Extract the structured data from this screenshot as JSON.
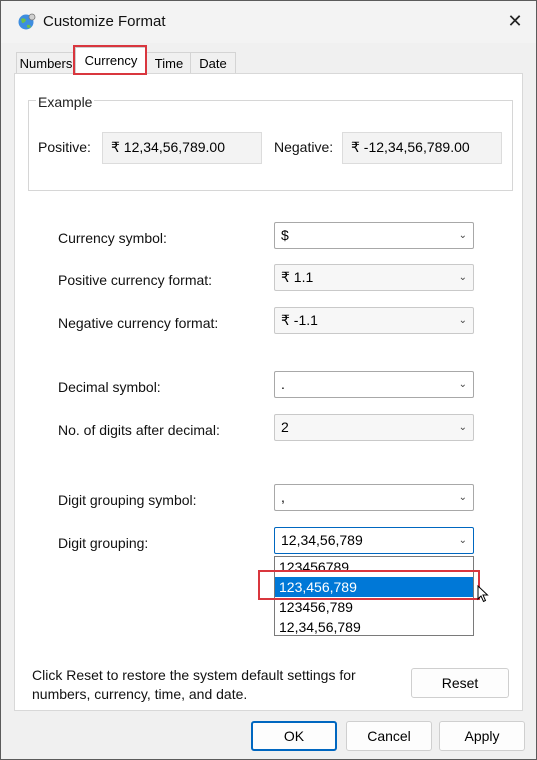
{
  "window": {
    "title": "Customize Format"
  },
  "tabs": [
    "Numbers",
    "Currency",
    "Time",
    "Date"
  ],
  "example": {
    "title": "Example",
    "positive_label": "Positive:",
    "positive_value": "₹ 12,34,56,789.00",
    "negative_label": "Negative:",
    "negative_value": "₹ -12,34,56,789.00"
  },
  "fields": [
    {
      "label": "Currency symbol:",
      "value": "$"
    },
    {
      "label": "Positive currency format:",
      "value": "₹ 1.1"
    },
    {
      "label": "Negative currency format:",
      "value": "₹ -1.1"
    },
    {
      "label": "Decimal symbol:",
      "value": "."
    },
    {
      "label": "No. of digits after decimal:",
      "value": "2"
    },
    {
      "label": "Digit grouping symbol:",
      "value": ","
    },
    {
      "label": "Digit grouping:",
      "value": "12,34,56,789"
    }
  ],
  "digit_grouping_options": [
    "123456789",
    "123,456,789",
    "123456,789",
    "12,34,56,789"
  ],
  "digit_grouping_highlighted": "123,456,789",
  "reset_note": "Click Reset to restore the system default settings for numbers, currency, time, and date.",
  "buttons": {
    "reset": "Reset",
    "ok": "OK",
    "cancel": "Cancel",
    "apply": "Apply"
  },
  "colors": {
    "selection": "#0078d7",
    "highlight_box": "#d9363e",
    "primary_border": "#0067c0"
  },
  "icons": {
    "app": "globe-settings-icon",
    "close": "close-icon",
    "dropdown": "chevron-down-icon",
    "cursor": "mouse-pointer-icon"
  }
}
